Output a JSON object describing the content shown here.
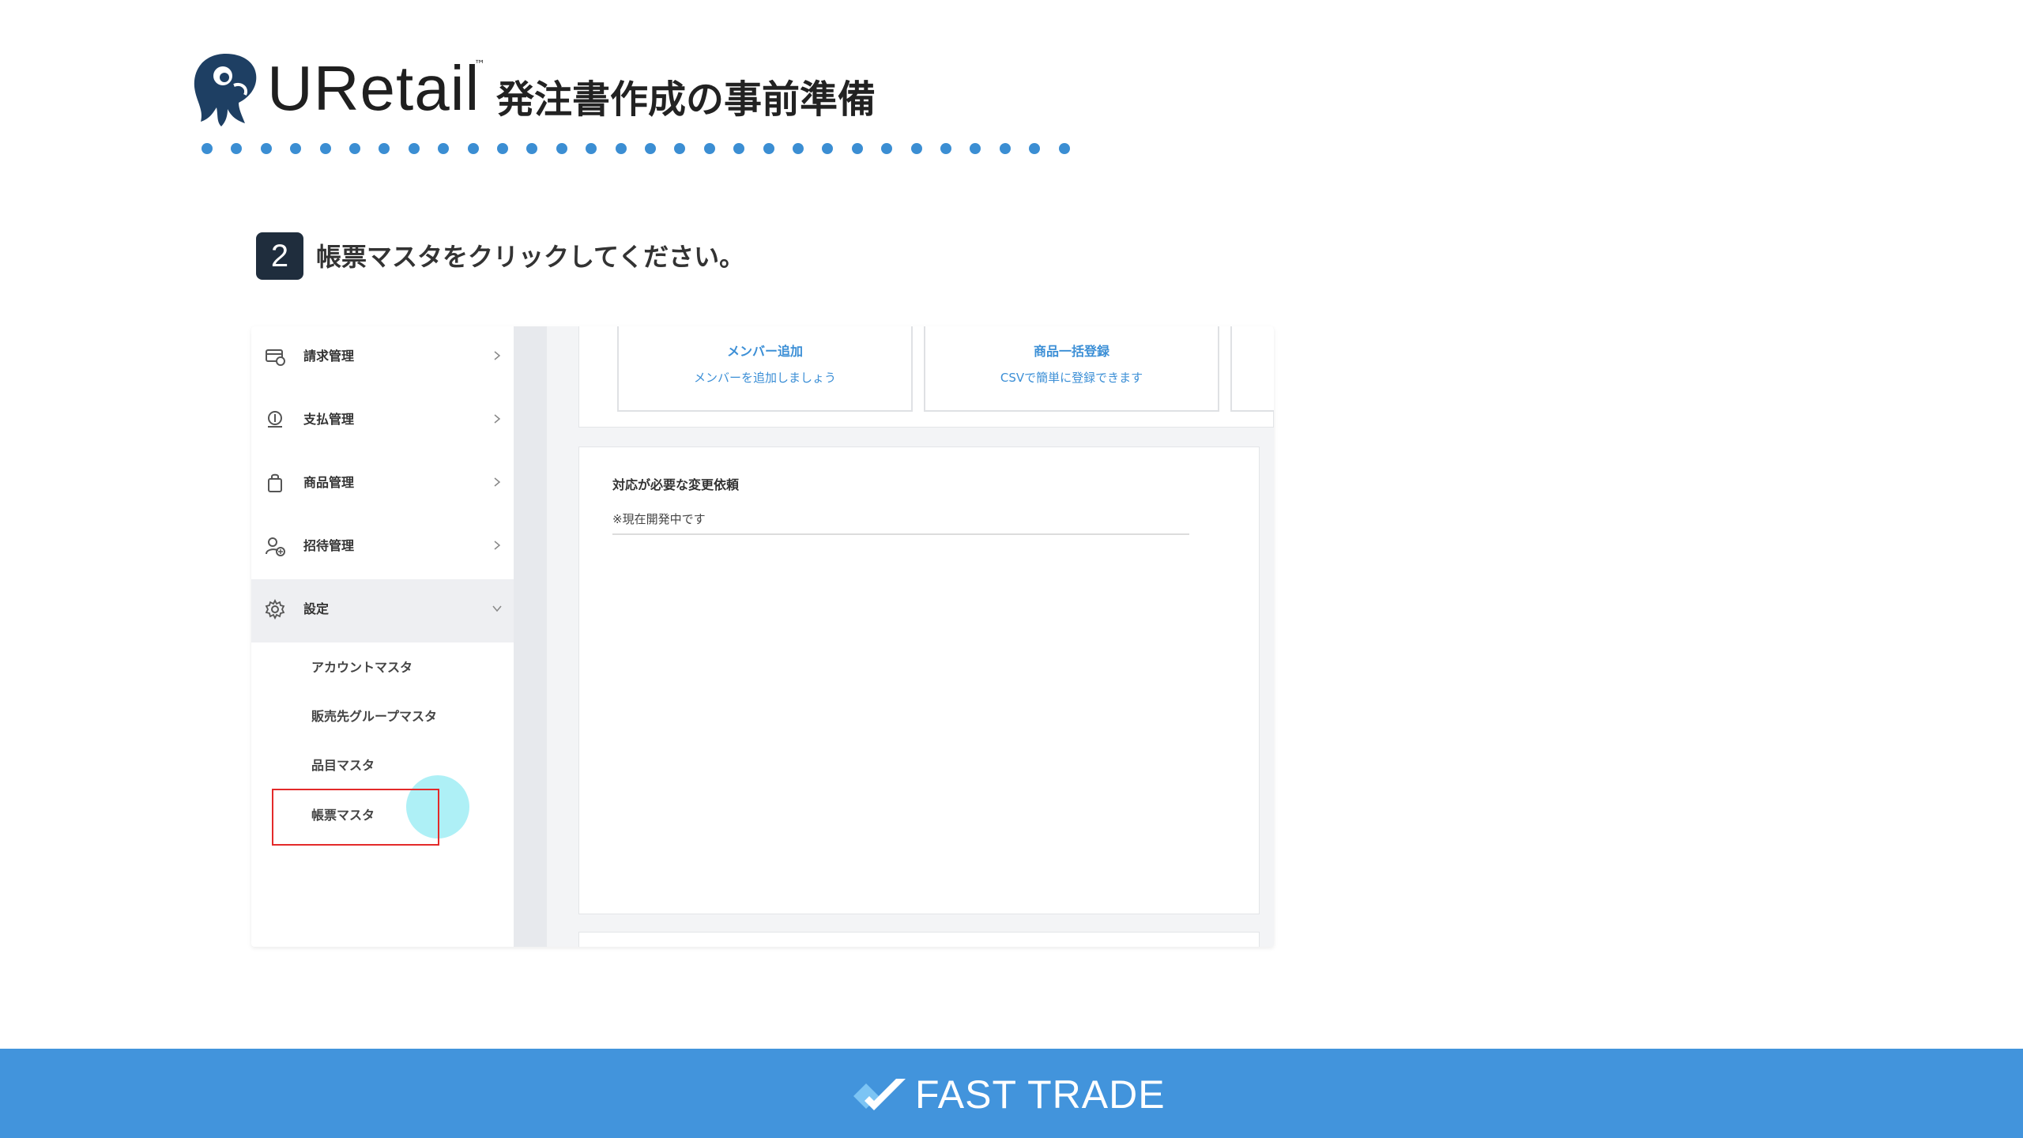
{
  "header": {
    "brand": "URetail",
    "trademark": "™",
    "title": "発注書作成の事前準備"
  },
  "step": {
    "number": "2",
    "instruction": "帳票マスタをクリックしてください。"
  },
  "sidebar": {
    "items": [
      {
        "label": "請求管理",
        "icon": "invoice-icon"
      },
      {
        "label": "支払管理",
        "icon": "payment-icon"
      },
      {
        "label": "商品管理",
        "icon": "product-bag-icon"
      },
      {
        "label": "招待管理",
        "icon": "invite-user-icon"
      },
      {
        "label": "設定",
        "icon": "gear-icon"
      }
    ],
    "sub_items": [
      "アカウントマスタ",
      "販売先グループマスタ",
      "品目マスタ",
      "帳票マスタ"
    ]
  },
  "main": {
    "cards": [
      {
        "title": "メンバー追加",
        "subtitle": "メンバーを追加しましょう"
      },
      {
        "title": "商品一括登録",
        "subtitle": "CSVで簡単に登録できます"
      }
    ],
    "panel": {
      "title": "対応が必要な変更依頼",
      "note": "※現在開発中です"
    }
  },
  "footer": {
    "brand": "FAST TRADE"
  },
  "colors": {
    "accent_blue": "#4294dc",
    "dot_blue": "#3b8ed3",
    "link_blue": "#3c8fd6",
    "highlight_red": "#e32a2a",
    "badge_dark": "#1f2d3d"
  }
}
